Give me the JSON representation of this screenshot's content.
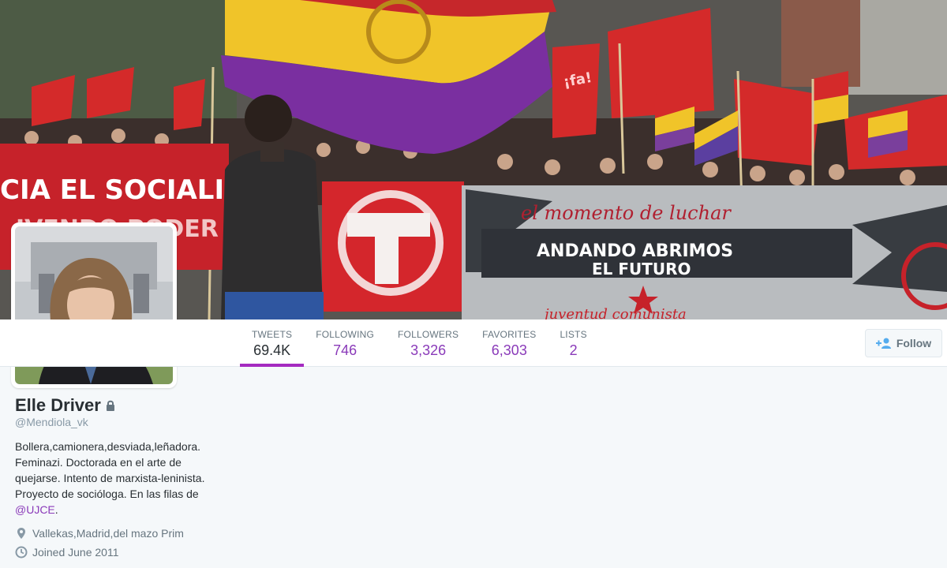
{
  "header_photo": {
    "banner_left_text": "CIA EL SOCIALISM",
    "banner_left_sub": "IVENDO PODER PC",
    "banner_right_top": "el momento de luchar",
    "banner_right_main1": "ANDANDO ABRIMOS",
    "banner_right_main2": "EL FUTURO",
    "banner_right_bottom": "juventud comunista",
    "flag_text": "¡fa!"
  },
  "nav": {
    "stats": [
      {
        "label": "TWEETS",
        "value": "69.4K",
        "active": true
      },
      {
        "label": "FOLLOWING",
        "value": "746"
      },
      {
        "label": "FOLLOWERS",
        "value": "3,326"
      },
      {
        "label": "FAVORITES",
        "value": "6,303"
      },
      {
        "label": "LISTS",
        "value": "2"
      }
    ],
    "follow_label": "Follow"
  },
  "profile": {
    "name": "Elle Driver",
    "handle": "@Mendiola_vk",
    "bio_text": "Bollera,camionera,desviada,leñadora. Feminazi. Doctorada en el arte de quejarse. Intento de marxista-leninista. Proyecto de socióloga. En las filas de ",
    "bio_mention": "@UJCE",
    "bio_end": ".",
    "location": "Vallekas,Madrid,del mazo Prim",
    "joined": "Joined June 2011"
  },
  "colors": {
    "accent": "#8a3ab9",
    "active_underline": "#a52ac0",
    "page_bg": "#f5f8fa"
  },
  "icons": [
    "lock-icon",
    "add-user-icon",
    "location-pin-icon",
    "calendar-clock-icon"
  ]
}
